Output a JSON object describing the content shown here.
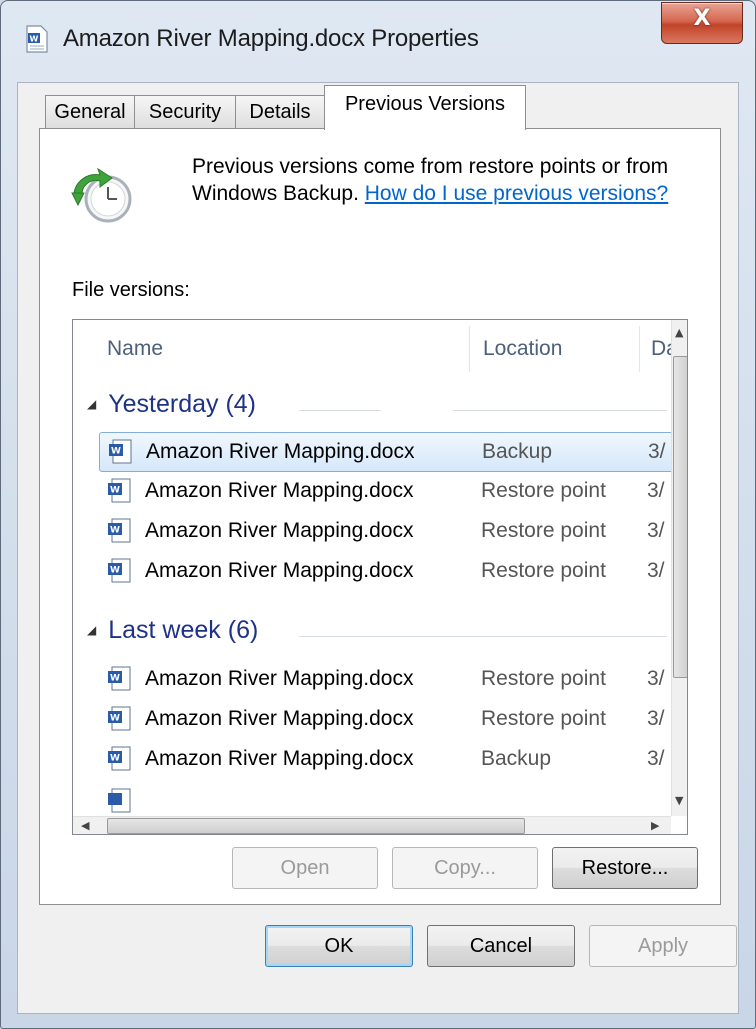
{
  "window": {
    "title": "Amazon River Mapping.docx Properties",
    "close_label": "X"
  },
  "tabs": [
    {
      "label": "General",
      "active": false
    },
    {
      "label": "Security",
      "active": false
    },
    {
      "label": "Details",
      "active": false
    },
    {
      "label": "Previous Versions",
      "active": true
    }
  ],
  "intro": {
    "text": "Previous versions come from restore points or from Windows Backup.",
    "link": "How do I use previous versions?"
  },
  "file_versions_label": "File versions:",
  "list": {
    "columns": [
      "Name",
      "Location",
      "Da"
    ],
    "groups": [
      {
        "title": "Yesterday (4)",
        "rows": [
          {
            "name": "Amazon River Mapping.docx",
            "location": "Backup",
            "date": "3/",
            "selected": true
          },
          {
            "name": "Amazon River Mapping.docx",
            "location": "Restore point",
            "date": "3/",
            "selected": false
          },
          {
            "name": "Amazon River Mapping.docx",
            "location": "Restore point",
            "date": "3/",
            "selected": false
          },
          {
            "name": "Amazon River Mapping.docx",
            "location": "Restore point",
            "date": "3/",
            "selected": false
          }
        ]
      },
      {
        "title": "Last week (6)",
        "rows": [
          {
            "name": "Amazon River Mapping.docx",
            "location": "Restore point",
            "date": "3/",
            "selected": false
          },
          {
            "name": "Amazon River Mapping.docx",
            "location": "Restore point",
            "date": "3/",
            "selected": false
          },
          {
            "name": "Amazon River Mapping.docx",
            "location": "Backup",
            "date": "3/",
            "selected": false
          }
        ]
      }
    ]
  },
  "panel_buttons": {
    "open": "Open",
    "copy": "Copy...",
    "restore": "Restore..."
  },
  "dialog_buttons": {
    "ok": "OK",
    "cancel": "Cancel",
    "apply": "Apply"
  },
  "colors": {
    "link": "#0066cc",
    "group_header": "#1e3287",
    "selection": "#d5e8fa"
  }
}
